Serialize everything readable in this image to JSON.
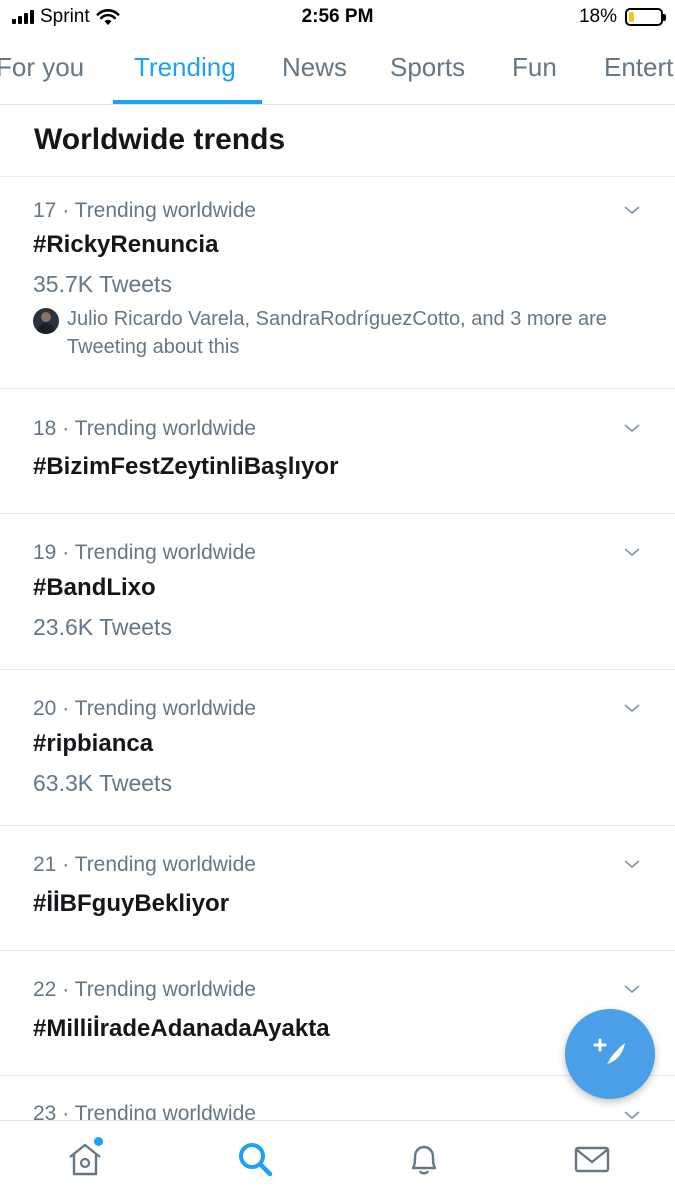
{
  "status_bar": {
    "carrier": "Sprint",
    "time": "2:56 PM",
    "battery_percent": "18%",
    "battery_level": 0.18,
    "icons": [
      "signal-icon",
      "wifi-icon",
      "battery-icon"
    ]
  },
  "tabs": [
    {
      "label": "For you",
      "active": false
    },
    {
      "label": "Trending",
      "active": true
    },
    {
      "label": "News",
      "active": false
    },
    {
      "label": "Sports",
      "active": false
    },
    {
      "label": "Fun",
      "active": false
    },
    {
      "label": "Entert",
      "active": false
    }
  ],
  "section_title": "Worldwide trends",
  "trends": [
    {
      "meta": "17 · Trending worldwide",
      "name": "#RickyRenuncia",
      "count": "35.7K Tweets",
      "context": "Julio Ricardo Varela, SandraRodríguezCotto, and 3 more are Tweeting about this"
    },
    {
      "meta": "18 · Trending worldwide",
      "name": "#BizimFestZeytinliBaşlıyor",
      "count": "",
      "context": ""
    },
    {
      "meta": "19 · Trending worldwide",
      "name": "#BandLixo",
      "count": "23.6K Tweets",
      "context": ""
    },
    {
      "meta": "20 · Trending worldwide",
      "name": "#ripbianca",
      "count": "63.3K Tweets",
      "context": ""
    },
    {
      "meta": "21 · Trending worldwide",
      "name": "#İİBFguyBekliyor",
      "count": "",
      "context": ""
    },
    {
      "meta": "22 · Trending worldwide",
      "name": "#Milliİrade​AdanadaAyakta",
      "count": "",
      "context": ""
    },
    {
      "meta": "23 · Trending worldwide",
      "name": "",
      "count": "",
      "context": ""
    }
  ],
  "bottom_nav": [
    {
      "icon": "home-icon",
      "has_notification": true
    },
    {
      "icon": "search-icon",
      "active": true
    },
    {
      "icon": "bell-icon"
    },
    {
      "icon": "mail-icon"
    }
  ],
  "fab_icon": "compose-tweet-icon",
  "colors": {
    "accent": "#1da1f2",
    "fab": "#4a9fe8",
    "secondary_text": "#657786",
    "primary_text": "#14171a",
    "battery_fill": "#f5c518"
  }
}
